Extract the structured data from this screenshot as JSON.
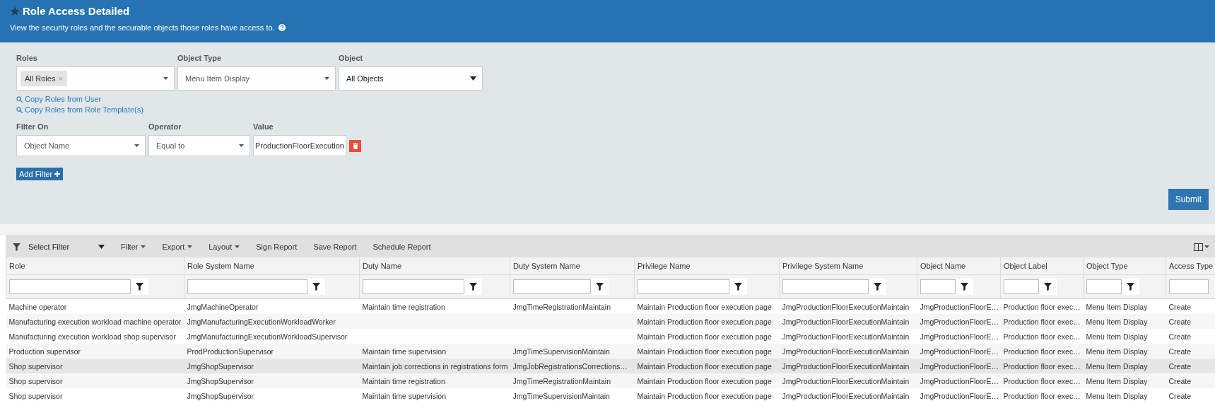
{
  "header": {
    "title": "Role Access Detailed",
    "subtitle": "View the security roles and the securable objects those roles have access to."
  },
  "criteria": {
    "roles": {
      "label": "Roles",
      "tags": [
        {
          "label": "All Roles",
          "remove": "×"
        }
      ]
    },
    "object_type": {
      "label": "Object Type",
      "value": "Menu Item Display"
    },
    "object": {
      "label": "Object",
      "value": "All Objects"
    },
    "links": [
      "Copy Roles from User",
      "Copy Roles from Role Template(s)"
    ],
    "filters": [
      {
        "filter_on": {
          "label": "Filter On",
          "value": "Object Name"
        },
        "operator": {
          "label": "Operator",
          "value": "Equal to"
        },
        "value": {
          "label": "Value",
          "value": "ProductionFloorExecution"
        }
      }
    ],
    "add_filter": "Add Filter",
    "submit": "Submit"
  },
  "toolbar": {
    "select_filter": "Select Filter",
    "items": [
      {
        "label": "Filter",
        "has_menu": true
      },
      {
        "label": "Export",
        "has_menu": true
      },
      {
        "label": "Layout",
        "has_menu": true
      },
      {
        "label": "Sign Report",
        "has_menu": false
      },
      {
        "label": "Save Report",
        "has_menu": false
      },
      {
        "label": "Schedule Report",
        "has_menu": false
      }
    ]
  },
  "table": {
    "columns": [
      {
        "label": "Role",
        "filter_button": true
      },
      {
        "label": "Role System Name",
        "filter_button": true
      },
      {
        "label": "Duty Name",
        "filter_button": true
      },
      {
        "label": "Duty System Name",
        "filter_button": true
      },
      {
        "label": "Privilege Name",
        "filter_button": true
      },
      {
        "label": "Privilege System Name",
        "filter_button": true
      },
      {
        "label": "Object Name",
        "filter_button": true
      },
      {
        "label": "Object Label",
        "filter_button": true
      },
      {
        "label": "Object Type",
        "filter_button": true
      },
      {
        "label": "Access Type",
        "filter_button": false
      }
    ],
    "rows": [
      {
        "selected": false,
        "cells": [
          "Machine operator",
          "JmgMachineOperator",
          "Maintain time registration",
          "JmgTimeRegistrationMaintain",
          "Maintain Production floor execution page",
          "JmgProductionFloorExecutionMaintain",
          "JmgProductionFloorE…",
          "Production floor exec…",
          "Menu Item Display",
          "Create"
        ]
      },
      {
        "selected": false,
        "cells": [
          "Manufacturing execution workload machine operator",
          "JmgManufacturingExecutionWorkloadWorker",
          null,
          null,
          "Maintain Production floor execution page",
          "JmgProductionFloorExecutionMaintain",
          "JmgProductionFloorE…",
          "Production floor exec…",
          "Menu Item Display",
          "Create"
        ]
      },
      {
        "selected": false,
        "cells": [
          "Manufacturing execution workload shop supervisor",
          "JmgManufacturingExecutionWorkloadSupervisor",
          null,
          null,
          "Maintain Production floor execution page",
          "JmgProductionFloorExecutionMaintain",
          "JmgProductionFloorE…",
          "Production floor exec…",
          "Menu Item Display",
          "Create"
        ]
      },
      {
        "selected": false,
        "cells": [
          "Production supervisor",
          "ProdProductionSupervisor",
          "Maintain time supervision",
          "JmgTimeSupervisionMaintain",
          "Maintain Production floor execution page",
          "JmgProductionFloorExecutionMaintain",
          "JmgProductionFloorE…",
          "Production floor exec…",
          "Menu Item Display",
          "Create"
        ]
      },
      {
        "selected": true,
        "cells": [
          "Shop supervisor",
          "JmgShopSupervisor",
          "Maintain job corrections in registrations form",
          "JmgJobRegistrationsCorrections…",
          "Maintain Production floor execution page",
          "JmgProductionFloorExecutionMaintain",
          "JmgProductionFloorE…",
          "Production floor exec…",
          "Menu Item Display",
          "Create"
        ]
      },
      {
        "selected": false,
        "cells": [
          "Shop supervisor",
          "JmgShopSupervisor",
          "Maintain time registration",
          "JmgTimeRegistrationMaintain",
          "Maintain Production floor execution page",
          "JmgProductionFloorExecutionMaintain",
          "JmgProductionFloorE…",
          "Production floor exec…",
          "Menu Item Display",
          "Create"
        ]
      },
      {
        "selected": false,
        "cells": [
          "Shop supervisor",
          "JmgShopSupervisor",
          "Maintain time supervision",
          "JmgTimeSupervisionMaintain",
          "Maintain Production floor execution page",
          "JmgProductionFloorExecutionMaintain",
          "JmgProductionFloorE…",
          "Production floor exec…",
          "Menu Item Display",
          "Create"
        ]
      }
    ]
  }
}
